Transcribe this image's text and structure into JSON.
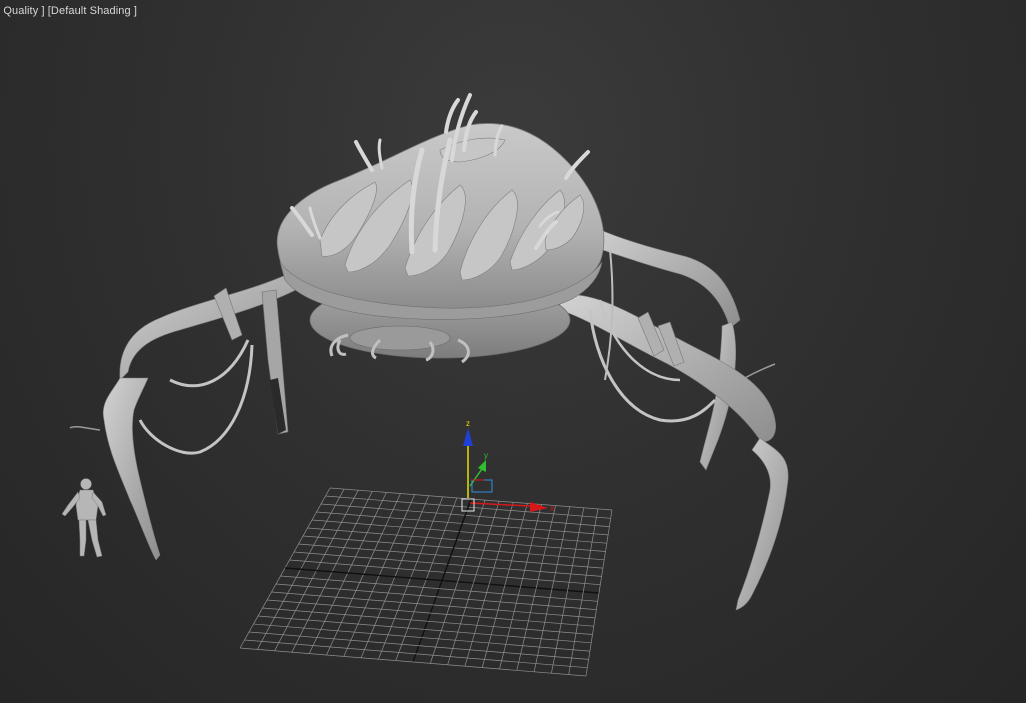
{
  "viewport": {
    "label_quality": "n Quality ]",
    "label_shading": "[Default Shading ]"
  },
  "gizmo": {
    "axis_z": "z",
    "axis_x": "x",
    "axis_y": "y"
  },
  "colors": {
    "background": "#303030",
    "model": "#b9b9b9",
    "grid": "#8f8f8f",
    "grid_axis": "#101010",
    "axis_x": "#d41818",
    "axis_y": "#2fbf2f",
    "axis_z": "#1f3fd8",
    "axis_highlight": "#e6e000"
  },
  "icons": {
    "gizmo": "transform-gizmo-icon",
    "pivot": "pivot-box-icon"
  }
}
